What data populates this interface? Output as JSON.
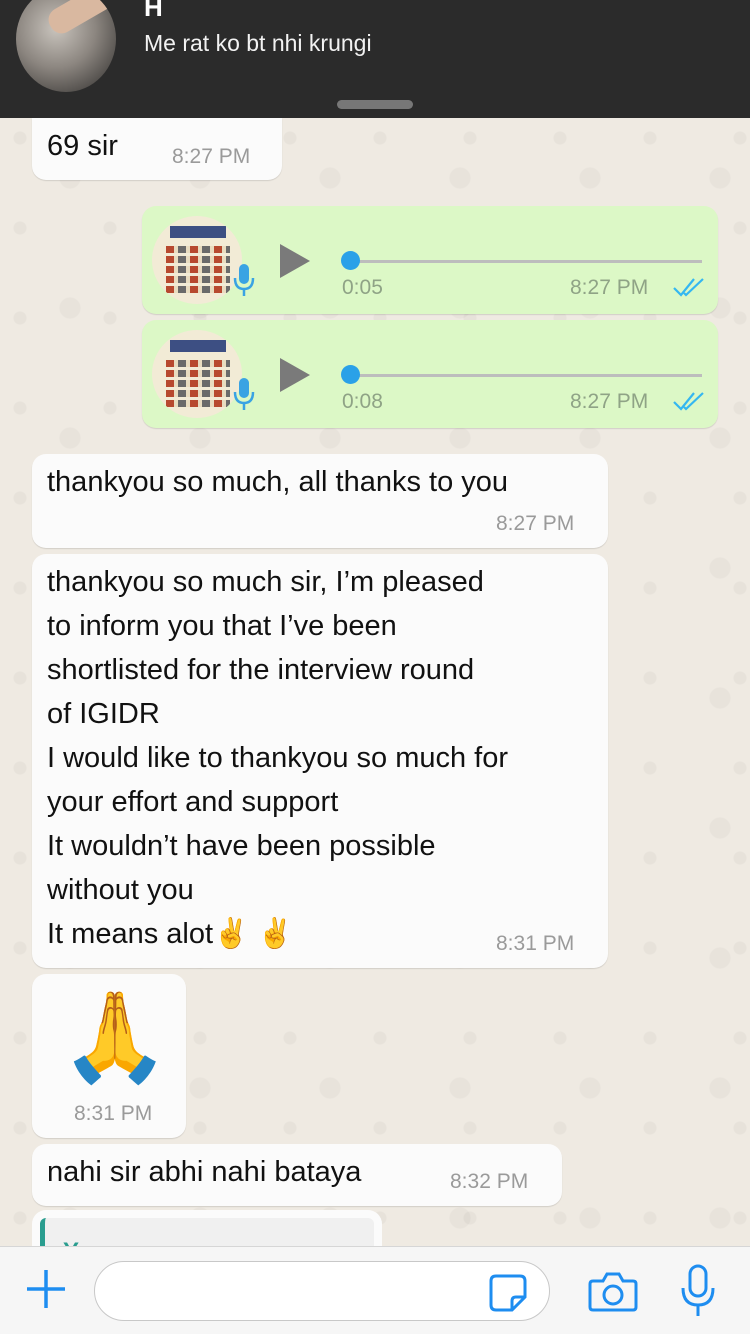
{
  "notification": {
    "sender": "H",
    "message": "Me rat ko bt nhi krungi"
  },
  "messages": [
    {
      "text": "69 sir",
      "time": "8:27 PM"
    },
    {
      "duration": "0:05",
      "time": "8:27 PM"
    },
    {
      "duration": "0:08",
      "time": "8:27 PM"
    },
    {
      "text": "thankyou so much, all thanks to you",
      "time": "8:27 PM"
    },
    {
      "text": "thankyou so much sir, I’m pleased\nto inform you that I’ve been\nshortlisted for the interview round\nof IGIDR\nI would like to thankyou so much for\nyour effort and support\nIt wouldn’t have been possible\nwithout you\nIt means alot✌️ ✌️",
      "time": "8:31 PM"
    },
    {
      "text": "🙏",
      "time": "8:31 PM"
    },
    {
      "text": "nahi sir abhi nahi bataya",
      "time": "8:32 PM"
    }
  ],
  "reply_preview": {
    "label": "You"
  },
  "input_bar": {
    "placeholder": ""
  },
  "colors": {
    "outgoing_bubble": "#dcf8c6",
    "incoming_bubble": "#fbfbfb",
    "accent_blue": "#2aa1e8",
    "read_ticks": "#34b7f1"
  }
}
